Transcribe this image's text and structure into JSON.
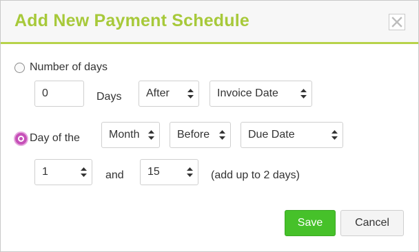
{
  "dialog": {
    "title": "Add New Payment Schedule"
  },
  "option_days": {
    "label": "Number of days",
    "selected": false,
    "days_value": "0",
    "days_unit_label": "Days",
    "direction": "After",
    "reference": "Invoice Date"
  },
  "option_day_of": {
    "label": "Day of the",
    "selected": true,
    "period": "Month",
    "direction": "Before",
    "reference": "Due Date",
    "day1": "1",
    "and_label": "and",
    "day2": "15",
    "hint": "(add up to 2 days)"
  },
  "buttons": {
    "save": "Save",
    "cancel": "Cancel"
  },
  "colors": {
    "title": "#a7c93a",
    "accent_line": "#b7d34a",
    "radio_selected": "#c650b8",
    "save_button": "#46c12a"
  },
  "icons": {
    "close": "close-icon",
    "select_arrows": "updown-arrows-icon"
  }
}
